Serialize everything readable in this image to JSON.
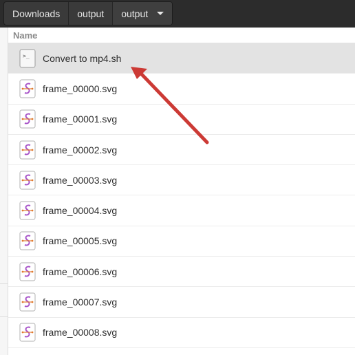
{
  "pathbar": {
    "segments": [
      {
        "label": "Downloads"
      },
      {
        "label": "output"
      },
      {
        "label": "output"
      }
    ],
    "dropdown_icon": "chevron-down-icon"
  },
  "list": {
    "column_header": "Name",
    "files": [
      {
        "name": "Convert to mp4.sh",
        "icon": "shell-script-icon",
        "selected": true
      },
      {
        "name": "frame_00000.svg",
        "icon": "svg-image-icon"
      },
      {
        "name": "frame_00001.svg",
        "icon": "svg-image-icon"
      },
      {
        "name": "frame_00002.svg",
        "icon": "svg-image-icon"
      },
      {
        "name": "frame_00003.svg",
        "icon": "svg-image-icon"
      },
      {
        "name": "frame_00004.svg",
        "icon": "svg-image-icon"
      },
      {
        "name": "frame_00005.svg",
        "icon": "svg-image-icon"
      },
      {
        "name": "frame_00006.svg",
        "icon": "svg-image-icon"
      },
      {
        "name": "frame_00007.svg",
        "icon": "svg-image-icon"
      },
      {
        "name": "frame_00008.svg",
        "icon": "svg-image-icon"
      }
    ]
  },
  "annotation": {
    "type": "arrow",
    "color": "#cc3a35",
    "points_to": "Convert to mp4.sh"
  },
  "colors": {
    "headerbar": "#2c2c2c",
    "selected_row": "#e3e3e3",
    "svg_icon_accent": "#a855c9"
  }
}
